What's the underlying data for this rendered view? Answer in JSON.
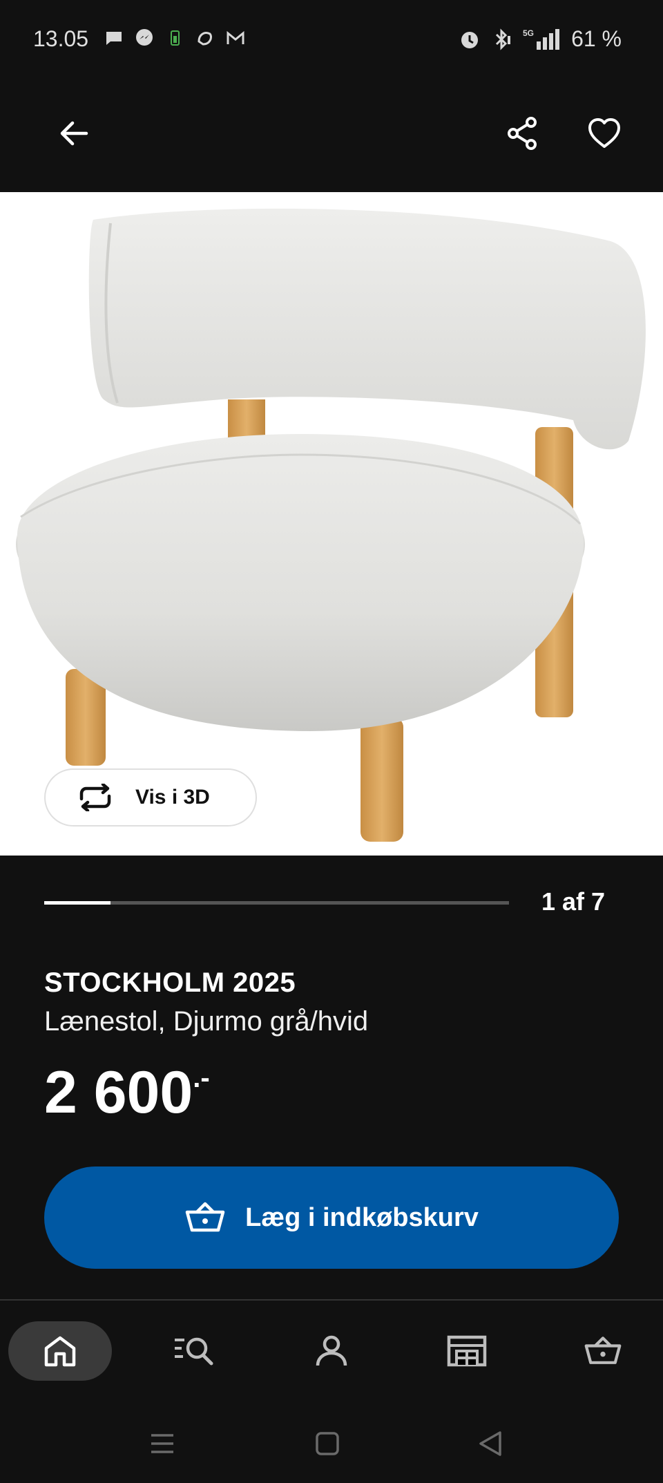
{
  "status_bar": {
    "time": "13.05",
    "battery": "61 %",
    "left_icons": [
      "message-icon",
      "messenger-icon",
      "battery-saver-icon",
      "photos-icon",
      "gmail-icon"
    ],
    "right_icons": [
      "alarm-icon",
      "bluetooth-icon",
      "5g-signal-icon"
    ]
  },
  "header": {
    "back_icon": "arrow-left-icon",
    "share_icon": "share-icon",
    "favorite_icon": "heart-icon"
  },
  "gallery": {
    "view_3d_label": "Vis i 3D",
    "counter": "1 af 7",
    "progress_fraction": 0.143
  },
  "product": {
    "name": "STOCKHOLM 2025",
    "description": "Lænestol, Djurmo grå/hvid",
    "price": "2 600",
    "price_suffix": ".-"
  },
  "cta": {
    "add_to_cart_label": "Læg i indkøbskurv"
  },
  "bottom_nav": {
    "items": [
      "home-icon",
      "search-icon",
      "profile-icon",
      "store-icon",
      "cart-icon"
    ],
    "active": "home-icon"
  },
  "colors": {
    "background": "#111111",
    "accent_blue": "#0058a3",
    "chair_fabric": "#e6e6e3",
    "wood": "#d6a45e"
  }
}
